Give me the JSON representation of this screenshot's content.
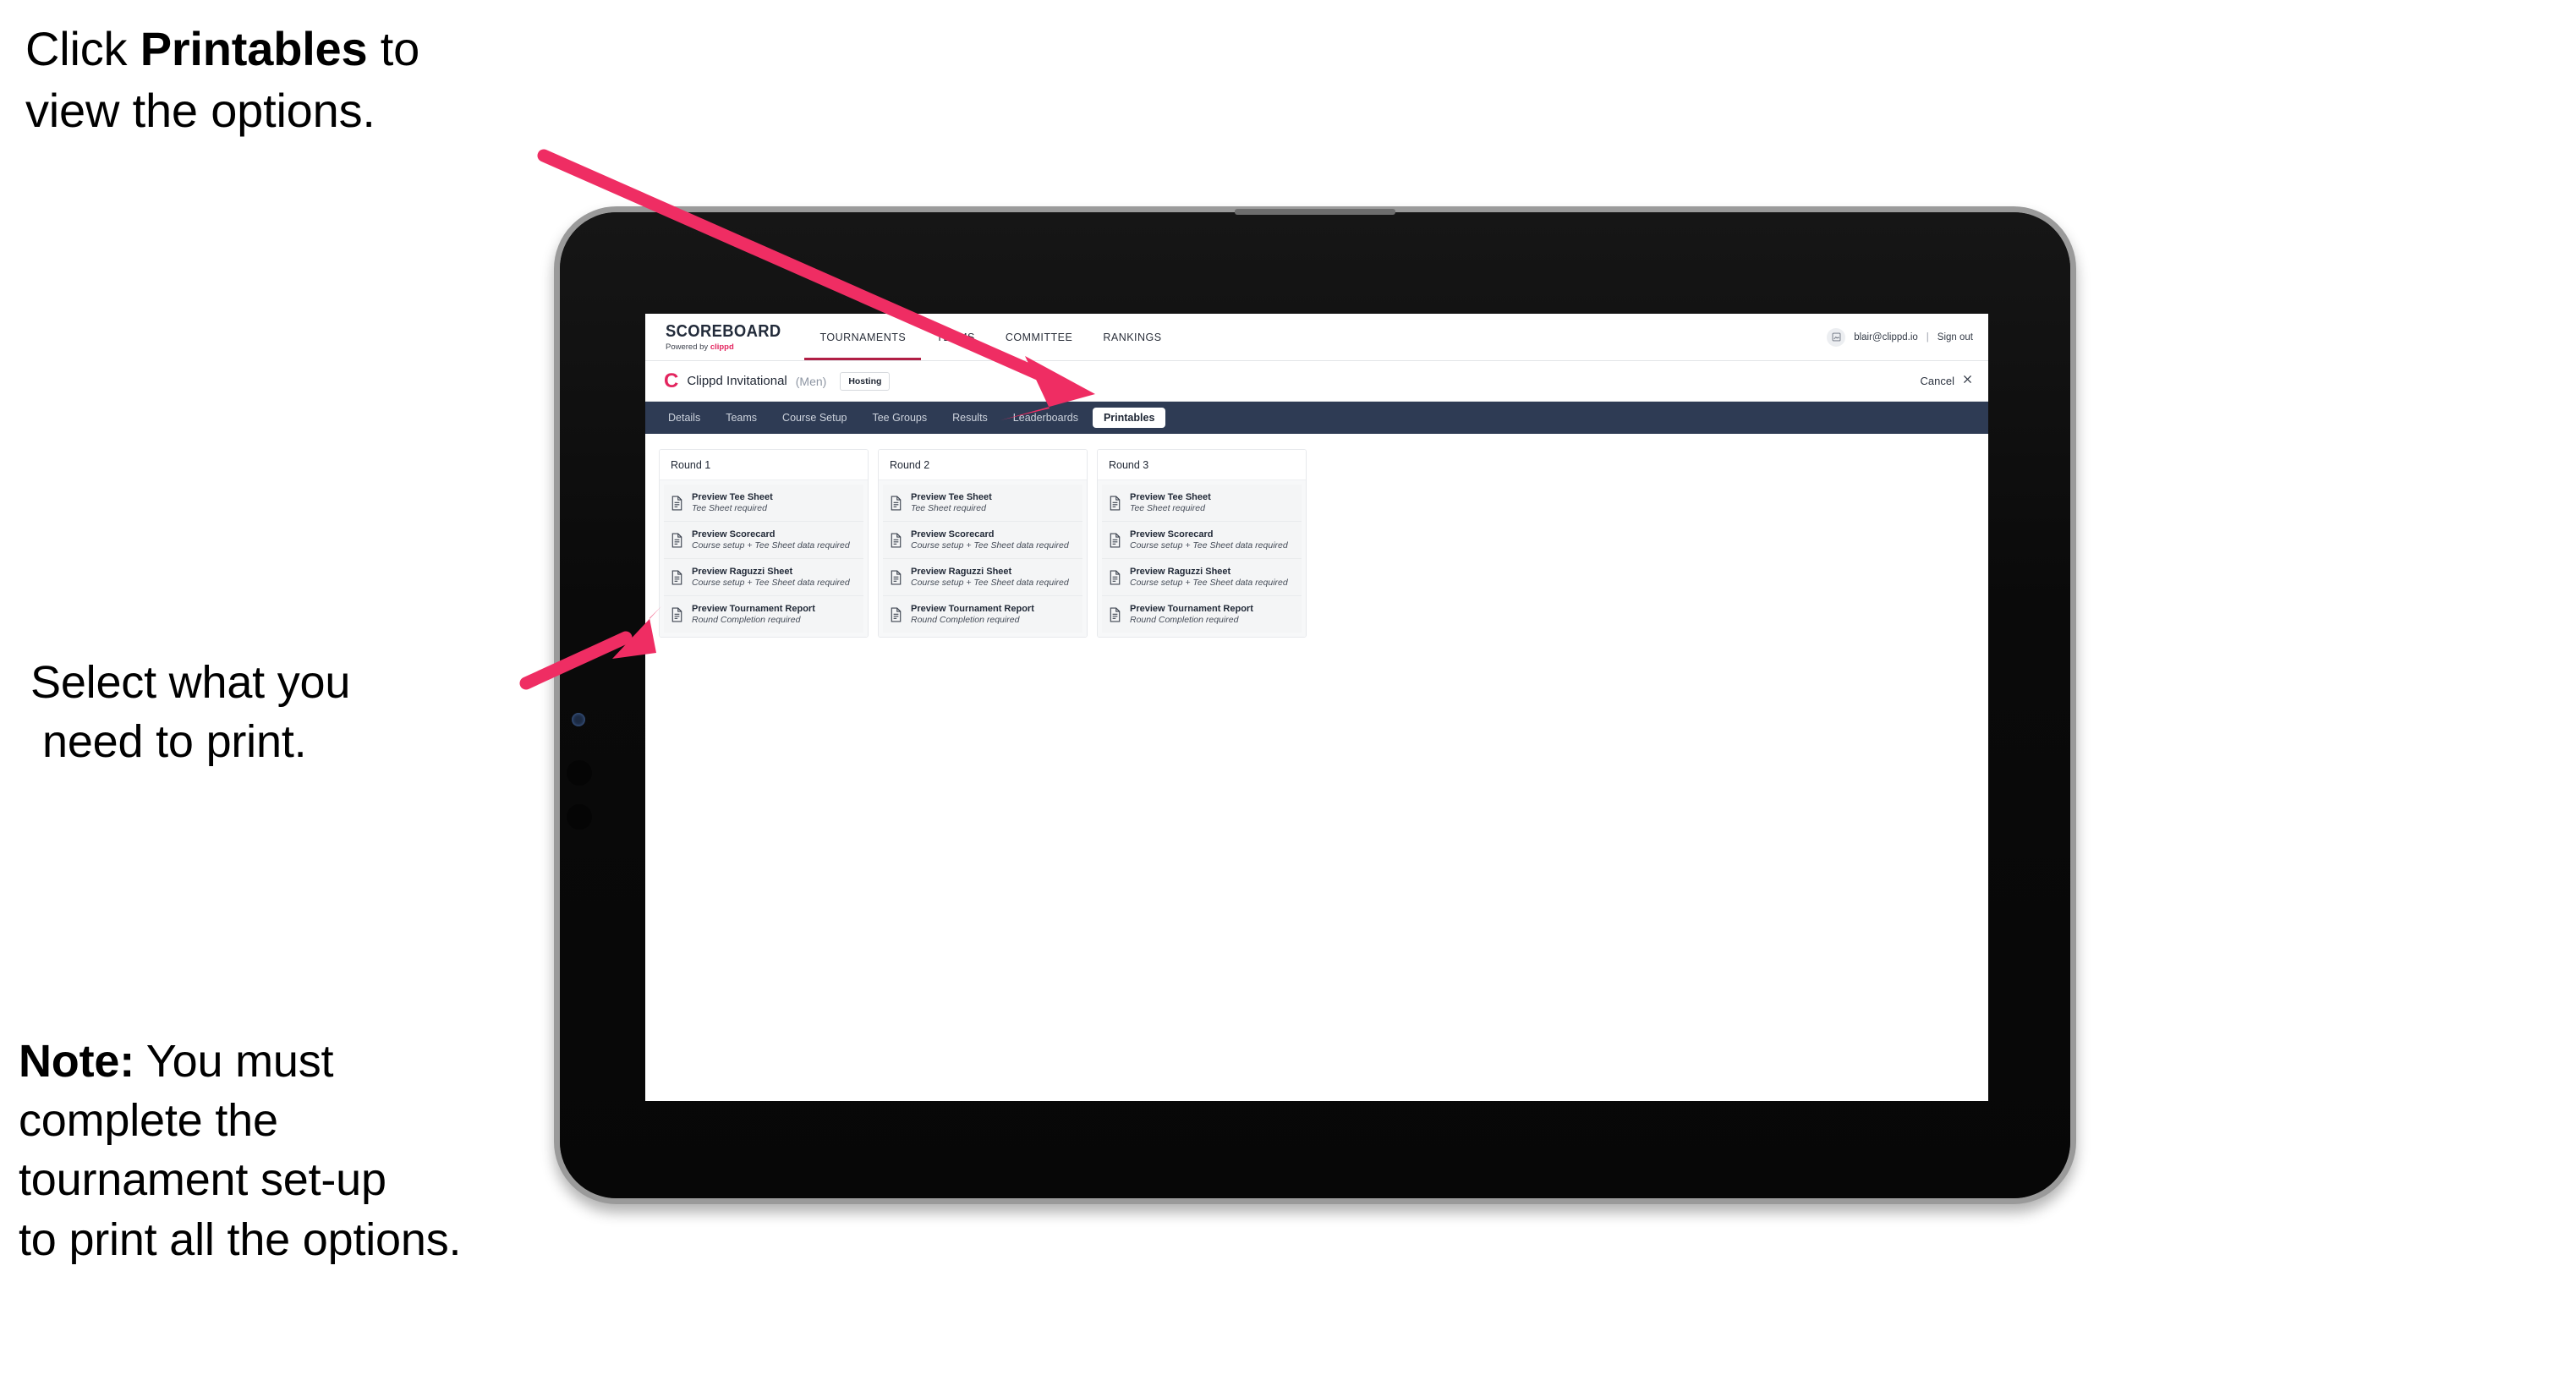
{
  "annotations": {
    "top": {
      "prefix": "Click ",
      "bold": "Printables",
      "suffix": " to",
      "line2": "view the options."
    },
    "middle": {
      "line1": "Select what you",
      "line2": "need to print."
    },
    "note": {
      "bold": "Note:",
      "line1_rest": " You must",
      "line2": "complete the",
      "line3": "tournament set-up",
      "line4": "to print all the options."
    }
  },
  "colors": {
    "arrow_pink": "#ef2d63",
    "brand_pink": "#e3255f",
    "tabbar_navy": "#2e3b54",
    "active_underline": "#b11f45"
  },
  "app": {
    "topnav": {
      "brand_title": "SCOREBOARD",
      "brand_sub_prefix": "Powered by ",
      "brand_sub_name": "clippd",
      "items": [
        {
          "label": "TOURNAMENTS",
          "active": true
        },
        {
          "label": "TEAMS",
          "active": false
        },
        {
          "label": "COMMITTEE",
          "active": false
        },
        {
          "label": "RANKINGS",
          "active": false
        }
      ],
      "avatar_icon": "user-avatar-icon",
      "user_email": "blair@clippd.io",
      "separator": "|",
      "sign_out": "Sign out"
    },
    "tournament_bar": {
      "logo_letter": "C",
      "name": "Clippd Invitational",
      "gender": "(Men)",
      "badge": "Hosting",
      "cancel_label": "Cancel",
      "cancel_icon": "close-x-icon"
    },
    "tabs": [
      {
        "label": "Details",
        "active": false
      },
      {
        "label": "Teams",
        "active": false
      },
      {
        "label": "Course Setup",
        "active": false
      },
      {
        "label": "Tee Groups",
        "active": false
      },
      {
        "label": "Results",
        "active": false
      },
      {
        "label": "Leaderboards",
        "active": false
      },
      {
        "label": "Printables",
        "active": true
      }
    ],
    "rounds": [
      {
        "title": "Round 1",
        "documents": [
          {
            "title": "Preview Tee Sheet",
            "requirement": "Tee Sheet required",
            "icon": "document-icon"
          },
          {
            "title": "Preview Scorecard",
            "requirement": "Course setup + Tee Sheet data required",
            "icon": "document-icon"
          },
          {
            "title": "Preview Raguzzi Sheet",
            "requirement": "Course setup + Tee Sheet data required",
            "icon": "document-icon"
          },
          {
            "title": "Preview Tournament Report",
            "requirement": "Round Completion required",
            "icon": "document-icon"
          }
        ]
      },
      {
        "title": "Round 2",
        "documents": [
          {
            "title": "Preview Tee Sheet",
            "requirement": "Tee Sheet required",
            "icon": "document-icon"
          },
          {
            "title": "Preview Scorecard",
            "requirement": "Course setup + Tee Sheet data required",
            "icon": "document-icon"
          },
          {
            "title": "Preview Raguzzi Sheet",
            "requirement": "Course setup + Tee Sheet data required",
            "icon": "document-icon"
          },
          {
            "title": "Preview Tournament Report",
            "requirement": "Round Completion required",
            "icon": "document-icon"
          }
        ]
      },
      {
        "title": "Round 3",
        "documents": [
          {
            "title": "Preview Tee Sheet",
            "requirement": "Tee Sheet required",
            "icon": "document-icon"
          },
          {
            "title": "Preview Scorecard",
            "requirement": "Course setup + Tee Sheet data required",
            "icon": "document-icon"
          },
          {
            "title": "Preview Raguzzi Sheet",
            "requirement": "Course setup + Tee Sheet data required",
            "icon": "document-icon"
          },
          {
            "title": "Preview Tournament Report",
            "requirement": "Round Completion required",
            "icon": "document-icon"
          }
        ]
      }
    ]
  }
}
